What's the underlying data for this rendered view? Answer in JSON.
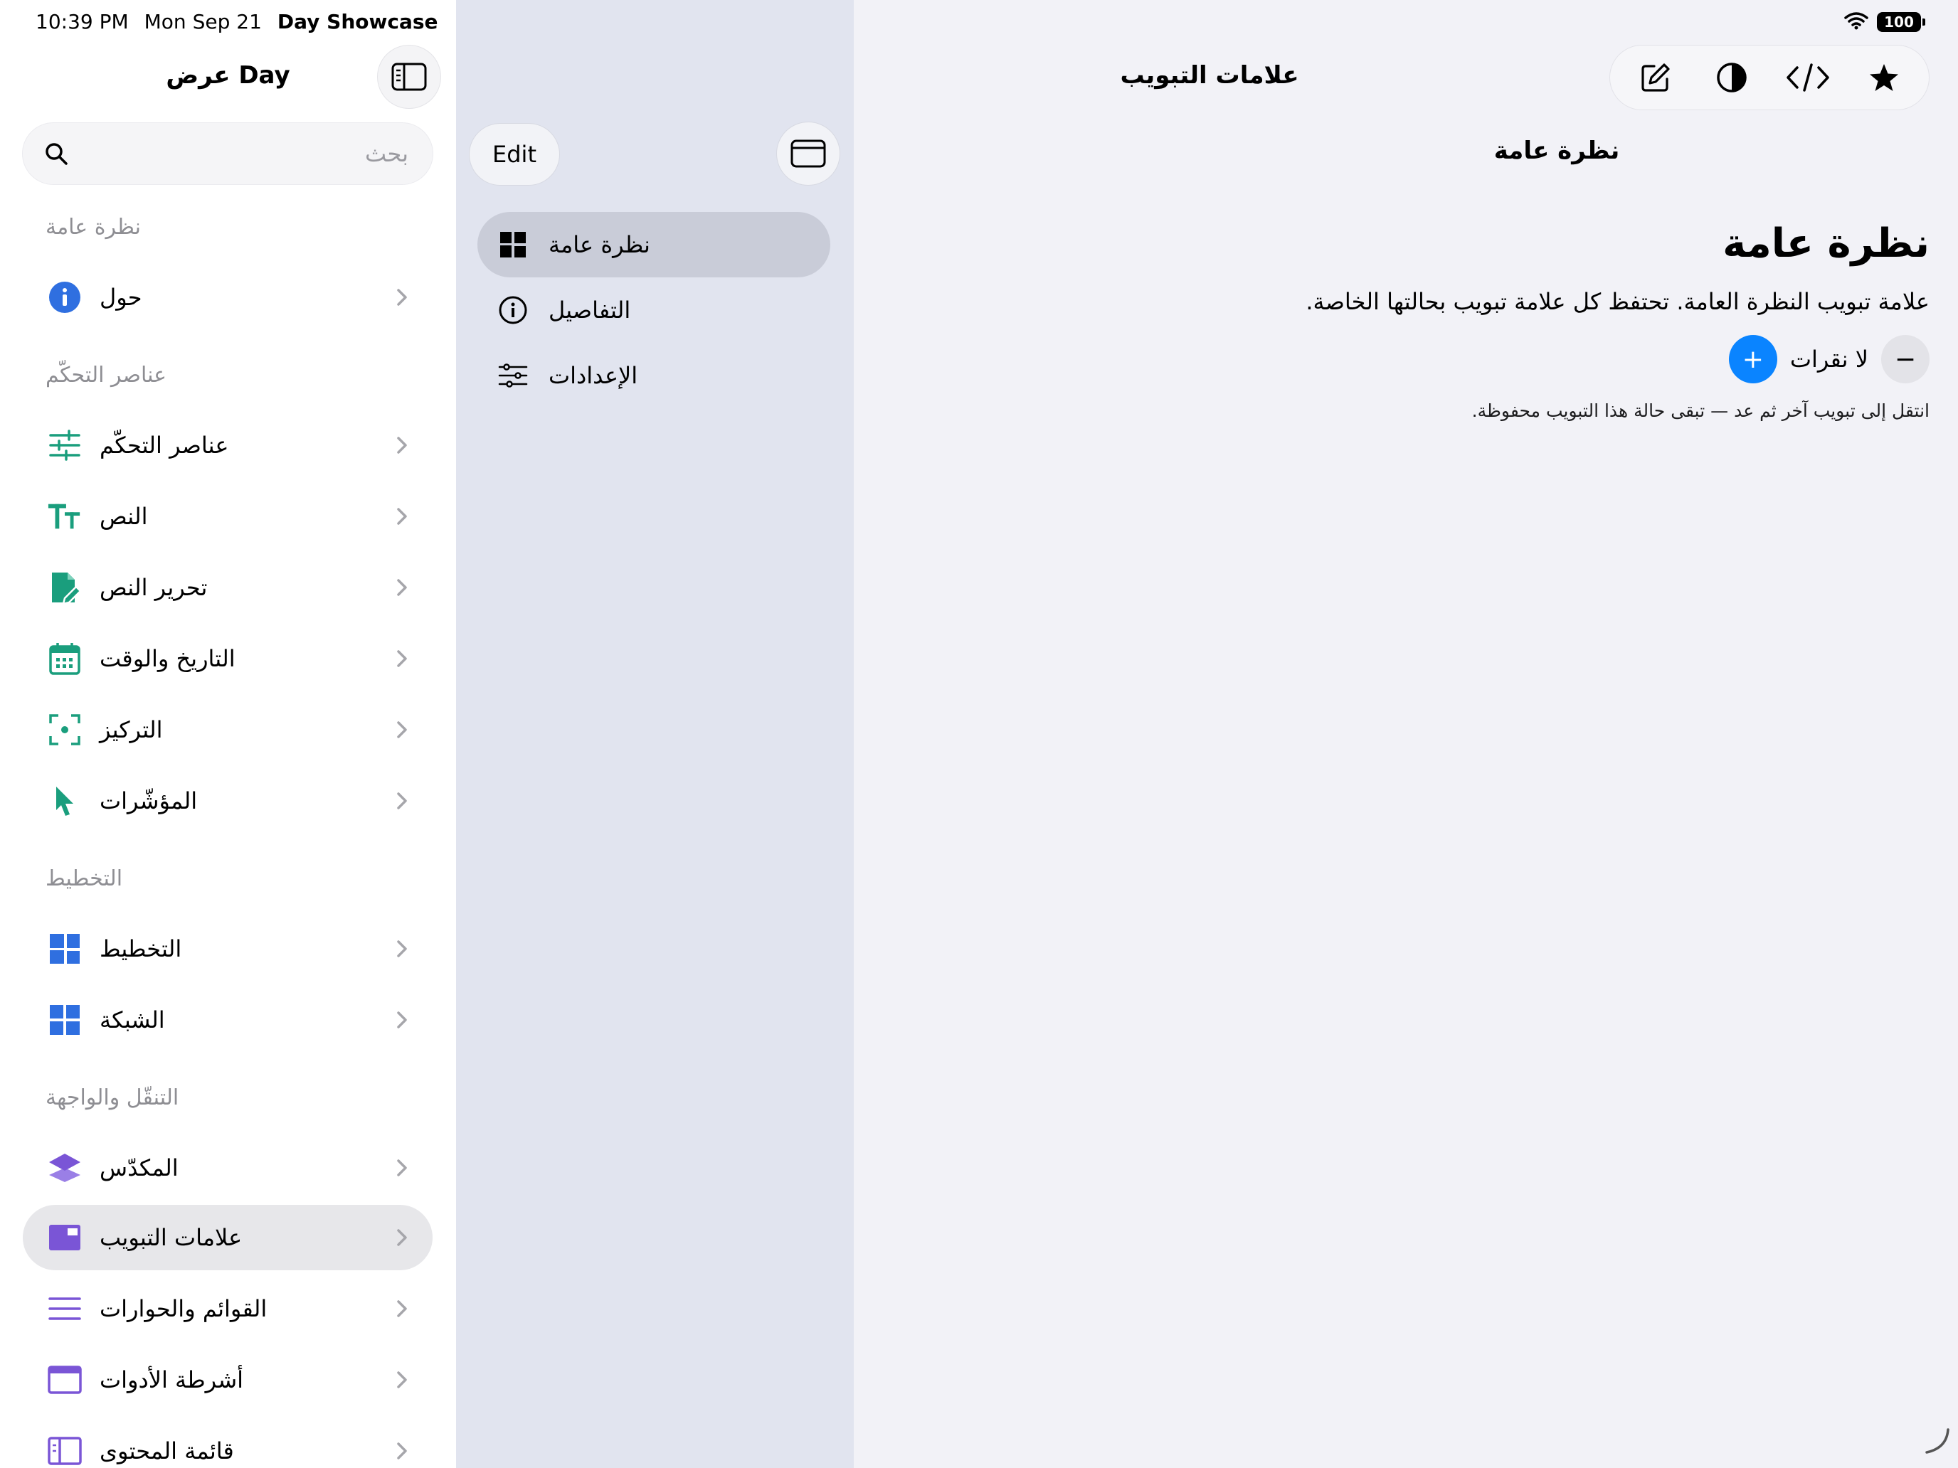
{
  "status_bar": {
    "time": "10:39 PM",
    "date": "Mon Sep 21",
    "app_name": "Day Showcase",
    "battery": "100"
  },
  "sidebar": {
    "title": "عرض Day",
    "search_placeholder": "بحث",
    "sections": [
      {
        "header": "نظرة عامة",
        "items": [
          {
            "label": "حول",
            "icon": "info-icon",
            "color": "#2f6fe0"
          }
        ]
      },
      {
        "header": "عناصر التحكّم",
        "items": [
          {
            "label": "عناصر التحكّم",
            "icon": "sliders-icon",
            "color": "#1a9e7d"
          },
          {
            "label": "النص",
            "icon": "text-size-icon",
            "color": "#1a9e7d"
          },
          {
            "label": "تحرير النص",
            "icon": "document-edit-icon",
            "color": "#1a9e7d"
          },
          {
            "label": "التاريخ والوقت",
            "icon": "calendar-icon",
            "color": "#1a9e7d"
          },
          {
            "label": "التركيز",
            "icon": "focus-icon",
            "color": "#1a9e7d"
          },
          {
            "label": "المؤشّرات",
            "icon": "pointer-icon",
            "color": "#1a9e7d"
          }
        ]
      },
      {
        "header": "التخطيط",
        "items": [
          {
            "label": "التخطيط",
            "icon": "layout-icon",
            "color": "#2f6fe0"
          },
          {
            "label": "الشبكة",
            "icon": "grid-icon",
            "color": "#2f6fe0"
          }
        ]
      },
      {
        "header": "التنقّل والواجهة",
        "items": [
          {
            "label": "المكدّس",
            "icon": "stack-icon",
            "color": "#7a55d6"
          },
          {
            "label": "علامات التبويب",
            "icon": "tabs-icon",
            "color": "#7a55d6",
            "selected": true
          },
          {
            "label": "القوائم والحوارات",
            "icon": "list-icon",
            "color": "#7a55d6"
          },
          {
            "label": "أشرطة الأدوات",
            "icon": "toolbar-icon",
            "color": "#7a55d6"
          },
          {
            "label": "قائمة المحتوى",
            "icon": "content-list-icon",
            "color": "#7a55d6"
          }
        ]
      }
    ]
  },
  "middle": {
    "edit_label": "Edit",
    "tabs": [
      {
        "label": "نظرة عامة",
        "icon": "overview-icon",
        "selected": true
      },
      {
        "label": "التفاصيل",
        "icon": "info-circle-icon"
      },
      {
        "label": "الإعدادات",
        "icon": "settings-sliders-icon"
      }
    ]
  },
  "detail": {
    "toolbar_title": "علامات التبويب",
    "toolbar_icons": [
      "compose-icon",
      "contrast-icon",
      "code-icon",
      "star-icon"
    ],
    "nav_title": "نظرة عامة",
    "heading": "نظرة عامة",
    "description": "علامة تبويب النظرة العامة. تحتفظ كل علامة تبويب بحالتها الخاصة.",
    "counter_label": "لا نقرات",
    "minus_label": "−",
    "plus_label": "+",
    "hint": "انتقل إلى تبويب آخر ثم عد — تبقى حالة هذا التبويب محفوظة."
  }
}
